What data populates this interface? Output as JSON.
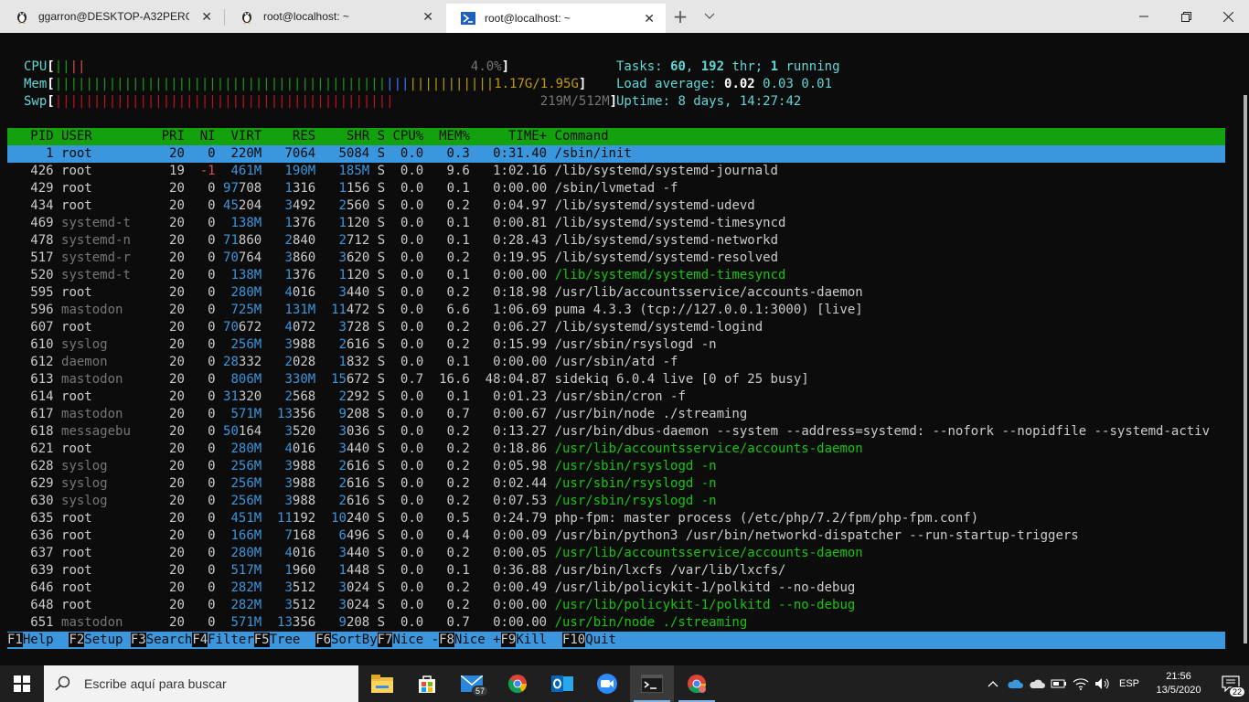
{
  "tabs": [
    {
      "label": "ggarron@DESKTOP-A32PERG: ~",
      "icon": "linux-penguin-icon",
      "active": false
    },
    {
      "label": "root@localhost: ~",
      "icon": "linux-penguin-icon",
      "active": false
    },
    {
      "label": "root@localhost: ~",
      "icon": "powershell-icon",
      "active": true
    }
  ],
  "titlebar": {
    "new_tab": "+",
    "dropdown": "⌵",
    "minimize": "—",
    "maximize": "❐",
    "close": "✕"
  },
  "meters": {
    "cpu": {
      "label": "CPU",
      "bar_green": "||",
      "bar_red": "||",
      "value": "4.0%"
    },
    "mem": {
      "label": "Mem",
      "bar_green": "|||||||||||||||||||||||||||||||||||||||||||",
      "bar_blue": "|||",
      "bar_yellow": "|||||||||||",
      "value": "1.17G/1.95G"
    },
    "swp": {
      "label": "Swp",
      "bar_red": "||||||||||||||||||||||||||||||||||||||||||||",
      "value": "219M/512M"
    }
  },
  "stats": {
    "tasks_label": "Tasks:",
    "tasks": "60",
    "thr": "192",
    "thr_label": "thr;",
    "running": "1",
    "running_label": "running",
    "load_label": "Load average:",
    "load1": "0.02",
    "load5": "0.03",
    "load15": "0.01",
    "uptime_label": "Uptime:",
    "uptime": "8 days, 14:27:42"
  },
  "columns": {
    "pid": "PID",
    "user": "USER",
    "pri": "PRI",
    "ni": "NI",
    "virt": "VIRT",
    "res": "RES",
    "shr": "SHR",
    "s": "S",
    "cpu": "CPU%",
    "mem": "MEM%",
    "time": "TIME+",
    "cmd": "Command"
  },
  "processes": [
    {
      "pid": "1",
      "user": "root",
      "pri": "20",
      "ni": "0",
      "virt": "220M",
      "res": "7064",
      "shr": "5084",
      "s": "S",
      "cpu": "0.0",
      "mem": "0.3",
      "time": "0:31.40",
      "cmd": "/sbin/init",
      "thread": false
    },
    {
      "pid": "426",
      "user": "root",
      "pri": "19",
      "ni": "-1",
      "virt": "461M",
      "res": "190M",
      "shr": "185M",
      "s": "S",
      "cpu": "0.0",
      "mem": "9.6",
      "time": "1:02.16",
      "cmd": "/lib/systemd/systemd-journald",
      "thread": false
    },
    {
      "pid": "429",
      "user": "root",
      "pri": "20",
      "ni": "0",
      "virt": "97708",
      "res": "1316",
      "shr": "1156",
      "s": "S",
      "cpu": "0.0",
      "mem": "0.1",
      "time": "0:00.00",
      "cmd": "/sbin/lvmetad -f",
      "thread": false
    },
    {
      "pid": "434",
      "user": "root",
      "pri": "20",
      "ni": "0",
      "virt": "45204",
      "res": "3492",
      "shr": "2560",
      "s": "S",
      "cpu": "0.0",
      "mem": "0.2",
      "time": "0:04.97",
      "cmd": "/lib/systemd/systemd-udevd",
      "thread": false
    },
    {
      "pid": "469",
      "user": "systemd-t",
      "pri": "20",
      "ni": "0",
      "virt": "138M",
      "res": "1376",
      "shr": "1120",
      "s": "S",
      "cpu": "0.0",
      "mem": "0.1",
      "time": "0:00.81",
      "cmd": "/lib/systemd/systemd-timesyncd",
      "thread": false
    },
    {
      "pid": "478",
      "user": "systemd-n",
      "pri": "20",
      "ni": "0",
      "virt": "71860",
      "res": "2840",
      "shr": "2712",
      "s": "S",
      "cpu": "0.0",
      "mem": "0.1",
      "time": "0:28.43",
      "cmd": "/lib/systemd/systemd-networkd",
      "thread": false
    },
    {
      "pid": "517",
      "user": "systemd-r",
      "pri": "20",
      "ni": "0",
      "virt": "70764",
      "res": "3860",
      "shr": "3620",
      "s": "S",
      "cpu": "0.0",
      "mem": "0.2",
      "time": "0:19.95",
      "cmd": "/lib/systemd/systemd-resolved",
      "thread": false
    },
    {
      "pid": "520",
      "user": "systemd-t",
      "pri": "20",
      "ni": "0",
      "virt": "138M",
      "res": "1376",
      "shr": "1120",
      "s": "S",
      "cpu": "0.0",
      "mem": "0.1",
      "time": "0:00.00",
      "cmd": "/lib/systemd/systemd-timesyncd",
      "thread": true
    },
    {
      "pid": "595",
      "user": "root",
      "pri": "20",
      "ni": "0",
      "virt": "280M",
      "res": "4016",
      "shr": "3440",
      "s": "S",
      "cpu": "0.0",
      "mem": "0.2",
      "time": "0:18.98",
      "cmd": "/usr/lib/accountsservice/accounts-daemon",
      "thread": false
    },
    {
      "pid": "596",
      "user": "mastodon",
      "pri": "20",
      "ni": "0",
      "virt": "725M",
      "res": "131M",
      "shr": "11472",
      "s": "S",
      "cpu": "0.0",
      "mem": "6.6",
      "time": "1:06.69",
      "cmd": "puma 4.3.3 (tcp://127.0.0.1:3000) [live]",
      "thread": false
    },
    {
      "pid": "607",
      "user": "root",
      "pri": "20",
      "ni": "0",
      "virt": "70672",
      "res": "4072",
      "shr": "3728",
      "s": "S",
      "cpu": "0.0",
      "mem": "0.2",
      "time": "0:06.27",
      "cmd": "/lib/systemd/systemd-logind",
      "thread": false
    },
    {
      "pid": "610",
      "user": "syslog",
      "pri": "20",
      "ni": "0",
      "virt": "256M",
      "res": "3988",
      "shr": "2616",
      "s": "S",
      "cpu": "0.0",
      "mem": "0.2",
      "time": "0:15.99",
      "cmd": "/usr/sbin/rsyslogd -n",
      "thread": false
    },
    {
      "pid": "612",
      "user": "daemon",
      "pri": "20",
      "ni": "0",
      "virt": "28332",
      "res": "2028",
      "shr": "1832",
      "s": "S",
      "cpu": "0.0",
      "mem": "0.1",
      "time": "0:00.00",
      "cmd": "/usr/sbin/atd -f",
      "thread": false
    },
    {
      "pid": "613",
      "user": "mastodon",
      "pri": "20",
      "ni": "0",
      "virt": "806M",
      "res": "330M",
      "shr": "15672",
      "s": "S",
      "cpu": "0.7",
      "mem": "16.6",
      "time": "48:04.87",
      "cmd": "sidekiq 6.0.4 live [0 of 25 busy]",
      "thread": false
    },
    {
      "pid": "614",
      "user": "root",
      "pri": "20",
      "ni": "0",
      "virt": "31320",
      "res": "2568",
      "shr": "2292",
      "s": "S",
      "cpu": "0.0",
      "mem": "0.1",
      "time": "0:01.23",
      "cmd": "/usr/sbin/cron -f",
      "thread": false
    },
    {
      "pid": "617",
      "user": "mastodon",
      "pri": "20",
      "ni": "0",
      "virt": "571M",
      "res": "13356",
      "shr": "9208",
      "s": "S",
      "cpu": "0.0",
      "mem": "0.7",
      "time": "0:00.67",
      "cmd": "/usr/bin/node ./streaming",
      "thread": false
    },
    {
      "pid": "618",
      "user": "messagebu",
      "pri": "20",
      "ni": "0",
      "virt": "50164",
      "res": "3520",
      "shr": "3036",
      "s": "S",
      "cpu": "0.0",
      "mem": "0.2",
      "time": "0:13.27",
      "cmd": "/usr/bin/dbus-daemon --system --address=systemd: --nofork --nopidfile --systemd-activ",
      "thread": false
    },
    {
      "pid": "621",
      "user": "root",
      "pri": "20",
      "ni": "0",
      "virt": "280M",
      "res": "4016",
      "shr": "3440",
      "s": "S",
      "cpu": "0.0",
      "mem": "0.2",
      "time": "0:18.86",
      "cmd": "/usr/lib/accountsservice/accounts-daemon",
      "thread": true
    },
    {
      "pid": "628",
      "user": "syslog",
      "pri": "20",
      "ni": "0",
      "virt": "256M",
      "res": "3988",
      "shr": "2616",
      "s": "S",
      "cpu": "0.0",
      "mem": "0.2",
      "time": "0:05.98",
      "cmd": "/usr/sbin/rsyslogd -n",
      "thread": true
    },
    {
      "pid": "629",
      "user": "syslog",
      "pri": "20",
      "ni": "0",
      "virt": "256M",
      "res": "3988",
      "shr": "2616",
      "s": "S",
      "cpu": "0.0",
      "mem": "0.2",
      "time": "0:02.44",
      "cmd": "/usr/sbin/rsyslogd -n",
      "thread": true
    },
    {
      "pid": "630",
      "user": "syslog",
      "pri": "20",
      "ni": "0",
      "virt": "256M",
      "res": "3988",
      "shr": "2616",
      "s": "S",
      "cpu": "0.0",
      "mem": "0.2",
      "time": "0:07.53",
      "cmd": "/usr/sbin/rsyslogd -n",
      "thread": true
    },
    {
      "pid": "635",
      "user": "root",
      "pri": "20",
      "ni": "0",
      "virt": "451M",
      "res": "11192",
      "shr": "10240",
      "s": "S",
      "cpu": "0.0",
      "mem": "0.5",
      "time": "0:24.79",
      "cmd": "php-fpm: master process (/etc/php/7.2/fpm/php-fpm.conf)",
      "thread": false
    },
    {
      "pid": "636",
      "user": "root",
      "pri": "20",
      "ni": "0",
      "virt": "166M",
      "res": "7168",
      "shr": "6496",
      "s": "S",
      "cpu": "0.0",
      "mem": "0.4",
      "time": "0:00.09",
      "cmd": "/usr/bin/python3 /usr/bin/networkd-dispatcher --run-startup-triggers",
      "thread": false
    },
    {
      "pid": "637",
      "user": "root",
      "pri": "20",
      "ni": "0",
      "virt": "280M",
      "res": "4016",
      "shr": "3440",
      "s": "S",
      "cpu": "0.0",
      "mem": "0.2",
      "time": "0:00.05",
      "cmd": "/usr/lib/accountsservice/accounts-daemon",
      "thread": true
    },
    {
      "pid": "639",
      "user": "root",
      "pri": "20",
      "ni": "0",
      "virt": "517M",
      "res": "1960",
      "shr": "1448",
      "s": "S",
      "cpu": "0.0",
      "mem": "0.1",
      "time": "0:36.88",
      "cmd": "/usr/bin/lxcfs /var/lib/lxcfs/",
      "thread": false
    },
    {
      "pid": "646",
      "user": "root",
      "pri": "20",
      "ni": "0",
      "virt": "282M",
      "res": "3512",
      "shr": "3024",
      "s": "S",
      "cpu": "0.0",
      "mem": "0.2",
      "time": "0:00.49",
      "cmd": "/usr/lib/policykit-1/polkitd --no-debug",
      "thread": false
    },
    {
      "pid": "648",
      "user": "root",
      "pri": "20",
      "ni": "0",
      "virt": "282M",
      "res": "3512",
      "shr": "3024",
      "s": "S",
      "cpu": "0.0",
      "mem": "0.2",
      "time": "0:00.00",
      "cmd": "/usr/lib/policykit-1/polkitd --no-debug",
      "thread": true
    },
    {
      "pid": "651",
      "user": "mastodon",
      "pri": "20",
      "ni": "0",
      "virt": "571M",
      "res": "13356",
      "shr": "9208",
      "s": "S",
      "cpu": "0.0",
      "mem": "0.7",
      "time": "0:00.00",
      "cmd": "/usr/bin/node ./streaming",
      "thread": true
    }
  ],
  "fkeys": [
    {
      "key": "F1",
      "label": "Help  "
    },
    {
      "key": "F2",
      "label": "Setup "
    },
    {
      "key": "F3",
      "label": "Search"
    },
    {
      "key": "F4",
      "label": "Filter"
    },
    {
      "key": "F5",
      "label": "Tree  "
    },
    {
      "key": "F6",
      "label": "SortBy"
    },
    {
      "key": "F7",
      "label": "Nice -"
    },
    {
      "key": "F8",
      "label": "Nice +"
    },
    {
      "key": "F9",
      "label": "Kill  "
    },
    {
      "key": "F10",
      "label": "Quit"
    }
  ],
  "taskbar": {
    "search_placeholder": "Escribe aquí para buscar",
    "mail_badge": "57",
    "lang": "ESP",
    "time": "21:56",
    "date": "13/5/2020",
    "notifications": "22"
  },
  "colors": {
    "green": "#13a10e",
    "cyan": "#3a96dd",
    "red": "#e74856",
    "yellow": "#c19c00",
    "blue": "#3b78ff"
  }
}
